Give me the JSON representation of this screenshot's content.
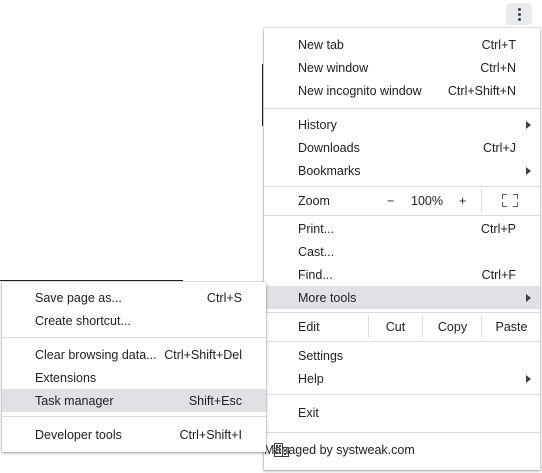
{
  "toolbar": {
    "menu_icon": "more-vert-icon"
  },
  "main_menu": {
    "new_tab": {
      "label": "New tab",
      "shortcut": "Ctrl+T"
    },
    "new_window": {
      "label": "New window",
      "shortcut": "Ctrl+N"
    },
    "new_incognito": {
      "label": "New incognito window",
      "shortcut": "Ctrl+Shift+N"
    },
    "history": {
      "label": "History"
    },
    "downloads": {
      "label": "Downloads",
      "shortcut": "Ctrl+J"
    },
    "bookmarks": {
      "label": "Bookmarks"
    },
    "zoom": {
      "label": "Zoom",
      "minus": "−",
      "level": "100%",
      "plus": "+",
      "fullscreen_icon": "fullscreen-icon"
    },
    "print": {
      "label": "Print...",
      "shortcut": "Ctrl+P"
    },
    "cast": {
      "label": "Cast..."
    },
    "find": {
      "label": "Find...",
      "shortcut": "Ctrl+F"
    },
    "more_tools": {
      "label": "More tools"
    },
    "edit": {
      "label": "Edit",
      "cut": "Cut",
      "copy": "Copy",
      "paste": "Paste"
    },
    "settings": {
      "label": "Settings"
    },
    "help": {
      "label": "Help"
    },
    "exit": {
      "label": "Exit"
    },
    "managed": {
      "label": "Managed by systweak.com",
      "icon": "building-icon"
    }
  },
  "more_tools_submenu": {
    "save_page": {
      "label": "Save page as...",
      "shortcut": "Ctrl+S"
    },
    "create_shortcut": {
      "label": "Create shortcut..."
    },
    "clear_data": {
      "label": "Clear browsing data...",
      "shortcut": "Ctrl+Shift+Del"
    },
    "extensions": {
      "label": "Extensions"
    },
    "task_manager": {
      "label": "Task manager",
      "shortcut": "Shift+Esc"
    },
    "developer_tools": {
      "label": "Developer tools",
      "shortcut": "Ctrl+Shift+I"
    }
  },
  "colors": {
    "highlight": "#dfe1e5",
    "separator": "#dadce0",
    "text": "#202124"
  }
}
